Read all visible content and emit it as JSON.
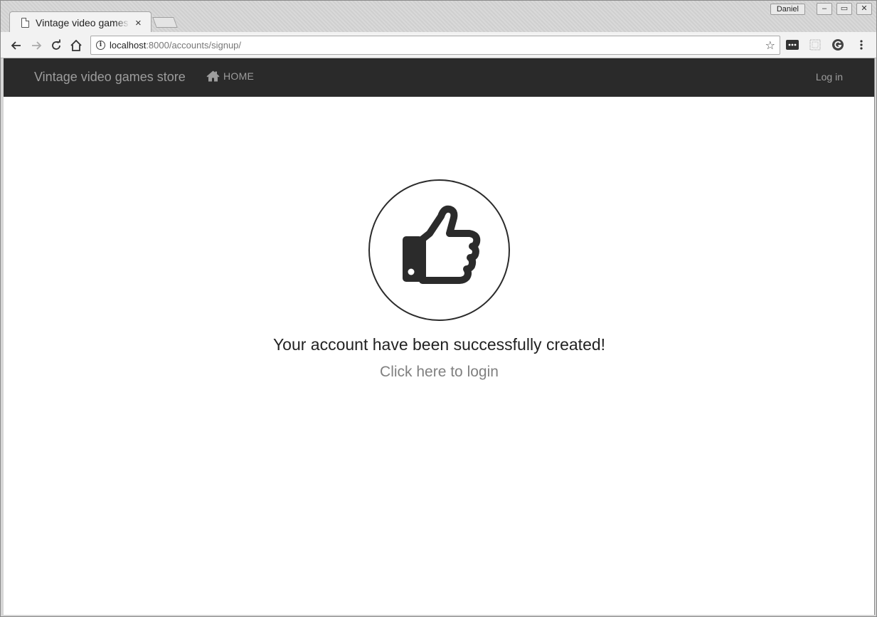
{
  "browser": {
    "tab": {
      "title": "Vintage video games store",
      "close_glyph": "×"
    },
    "user_badge": "Daniel",
    "window_controls": {
      "minimize": "–",
      "maximize": "▭",
      "close": "✕"
    },
    "address_bar": {
      "host": "localhost",
      "path": ":8000/accounts/signup/",
      "star_glyph": "☆"
    },
    "icons": [
      "back-icon",
      "forward-icon",
      "reload-icon",
      "home-icon",
      "info-icon",
      "bookmark-star-icon",
      "extension-password-icon",
      "extension-dotted-icon",
      "extension-grammarly-icon",
      "menu-kebab-icon"
    ]
  },
  "navbar": {
    "brand": "Vintage video games store",
    "home_label": "HOME",
    "login_label": "Log in"
  },
  "main": {
    "icon": "thumbs-up-icon",
    "message": "Your account have been successfully created!",
    "login_link": "Click here to login"
  },
  "colors": {
    "navbar_bg": "#2a2a2a",
    "navbar_text": "#9d9d9d",
    "message_text": "#222222",
    "link_text": "#808080"
  }
}
